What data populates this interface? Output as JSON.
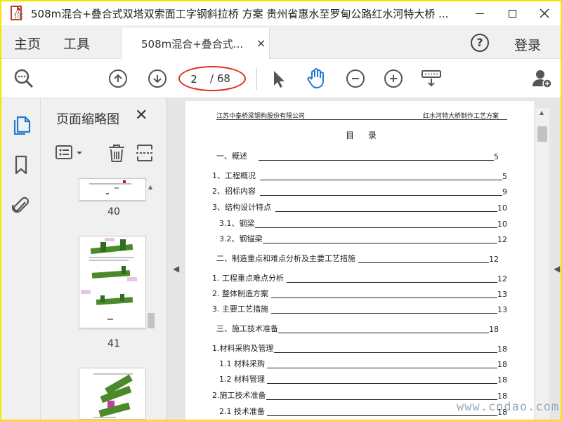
{
  "window": {
    "title": "508m混合+叠合式双塔双索面工字钢斜拉桥 方案 贵州省惠水至罗甸公路红水河特大桥 ...",
    "logo_watermark": "你"
  },
  "menu": {
    "home": "主页",
    "tools": "工具",
    "doc_tab": "508m混合+叠合式...",
    "tab_close": "×",
    "help": "?",
    "login": "登录"
  },
  "toolbar": {
    "current_page": "2",
    "page_total": "/ 68"
  },
  "sidebar": {
    "title": "页面缩略图",
    "close": "✕",
    "thumbnails": [
      {
        "label": "40"
      },
      {
        "label": "41"
      }
    ]
  },
  "document": {
    "header_left": "江苏中泰桥梁钢构股份有限公司",
    "header_right": "红水河特大桥制作工艺方案",
    "toc_title": "目 录",
    "toc": [
      {
        "text": "一、概述",
        "page": "5"
      },
      {
        "text": "1、工程概况",
        "page": "5"
      },
      {
        "text": "2、招标内容",
        "page": "9"
      },
      {
        "text": "3、结构设计特点",
        "page": "10"
      },
      {
        "text": "3.1、钢梁",
        "page": "10"
      },
      {
        "text": "3.2、钢锚梁",
        "page": "12"
      },
      {
        "text": "二、制造重点和难点分析及主要工艺措施",
        "page": "12"
      },
      {
        "text": "1. 工程重点难点分析",
        "page": "12"
      },
      {
        "text": "2. 整体制造方案",
        "page": "13"
      },
      {
        "text": "3. 主要工艺措施",
        "page": "13"
      },
      {
        "text": "三、施工技术准备",
        "page": "18"
      },
      {
        "text": "1.材料采购及管理",
        "page": "18"
      },
      {
        "text": "1.1  材料采购",
        "page": "18"
      },
      {
        "text": "1.2  材料管理",
        "page": "18"
      },
      {
        "text": "2.施工技术准备",
        "page": "18"
      },
      {
        "text": "2.1  技术准备",
        "page": "18"
      }
    ]
  },
  "watermark": "www.cndao.com",
  "colors": {
    "frame": "#f5e400",
    "annotation_red": "#e0281e",
    "hand_tool_blue": "#1e7ad3",
    "rail_active_blue": "#1e7ad3"
  }
}
